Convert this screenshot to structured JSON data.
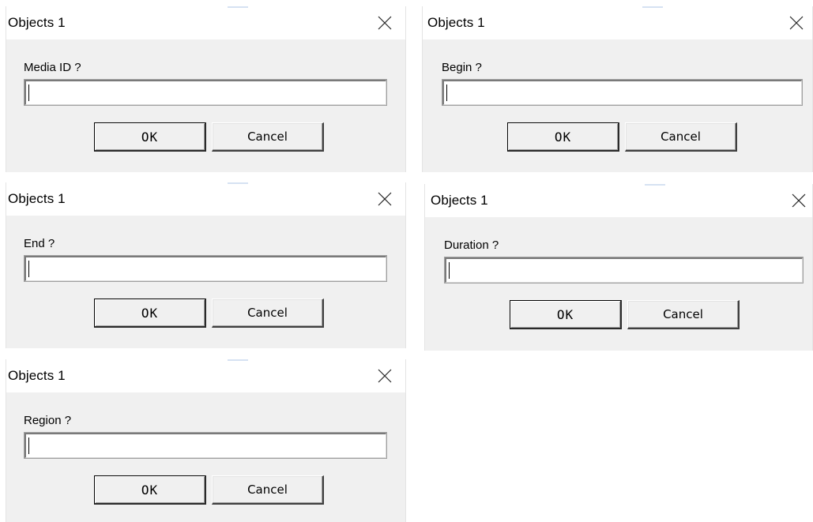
{
  "dialogs": [
    {
      "title": "Objects 1",
      "prompt": "Media ID ?",
      "value": "",
      "ok_label": "OK",
      "cancel_label": "Cancel",
      "close_icon": "close-icon"
    },
    {
      "title": "Objects 1",
      "prompt": "Begin ?",
      "value": "",
      "ok_label": "OK",
      "cancel_label": "Cancel",
      "close_icon": "close-icon"
    },
    {
      "title": "Objects 1",
      "prompt": "End ?",
      "value": "",
      "ok_label": "OK",
      "cancel_label": "Cancel",
      "close_icon": "close-icon"
    },
    {
      "title": "Objects 1",
      "prompt": "Duration ?",
      "value": "",
      "ok_label": "OK",
      "cancel_label": "Cancel",
      "close_icon": "close-icon"
    },
    {
      "title": "Objects 1",
      "prompt": "Region ?",
      "value": "",
      "ok_label": "OK",
      "cancel_label": "Cancel",
      "close_icon": "close-icon"
    }
  ]
}
